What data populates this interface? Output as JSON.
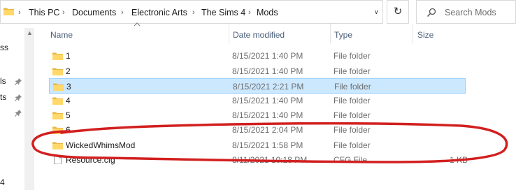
{
  "address_bar": {
    "crumbs": [
      "This PC",
      "Documents",
      "Electronic Arts",
      "The Sims 4",
      "Mods"
    ]
  },
  "search": {
    "placeholder": "Search Mods"
  },
  "nav_pane": {
    "items": [
      {
        "text": "ss",
        "pinned": false
      },
      {
        "text": "ls",
        "pinned": true
      },
      {
        "text": "ts",
        "pinned": true
      },
      {
        "text": "",
        "pinned": true
      },
      {
        "text": "4",
        "pinned": false
      }
    ]
  },
  "columns": {
    "name": "Name",
    "date": "Date modified",
    "type": "Type",
    "size": "Size"
  },
  "files": [
    {
      "name": "1",
      "date": "8/15/2021 1:40 PM",
      "type": "File folder",
      "size": "",
      "icon": "folder-icon"
    },
    {
      "name": "2",
      "date": "8/15/2021 1:40 PM",
      "type": "File folder",
      "size": "",
      "icon": "folder-icon"
    },
    {
      "name": "3",
      "date": "8/15/2021 2:21 PM",
      "type": "File folder",
      "size": "",
      "icon": "folder-icon",
      "selected": true
    },
    {
      "name": "4",
      "date": "8/15/2021 1:40 PM",
      "type": "File folder",
      "size": "",
      "icon": "folder-icon"
    },
    {
      "name": "5",
      "date": "8/15/2021 1:40 PM",
      "type": "File folder",
      "size": "",
      "icon": "folder-icon"
    },
    {
      "name": "6",
      "date": "8/15/2021 2:04 PM",
      "type": "File folder",
      "size": "",
      "icon": "folder-icon"
    },
    {
      "name": "WickedWhimsMod",
      "date": "8/15/2021 1:58 PM",
      "type": "File folder",
      "size": "",
      "icon": "folder-icon"
    },
    {
      "name": "Resource.cfg",
      "date": "8/11/2021 10:18 PM",
      "type": "CFG File",
      "size": "1 KB",
      "icon": "file-icon"
    }
  ],
  "colors": {
    "selection_fill": "#cce8ff",
    "selection_border": "#99d1ff",
    "folder_yellow": "#ffd869",
    "annotation_red": "#d21f1f"
  }
}
